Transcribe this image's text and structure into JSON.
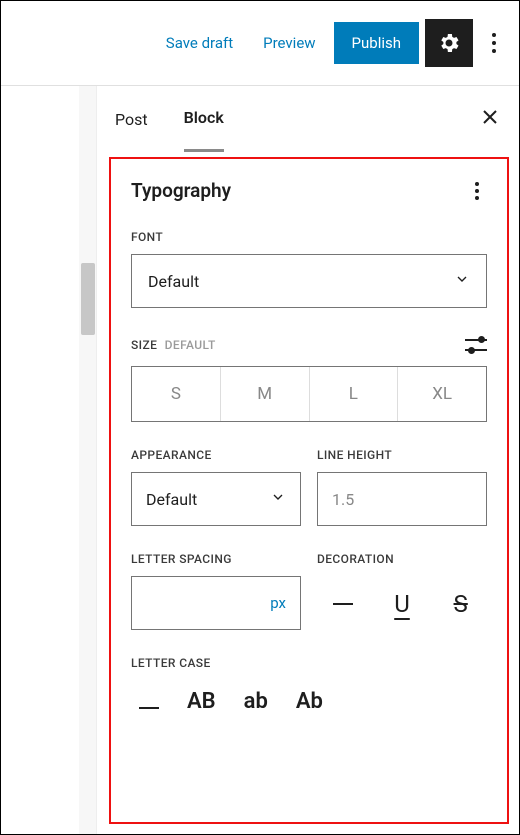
{
  "topbar": {
    "save_draft": "Save draft",
    "preview": "Preview",
    "publish": "Publish"
  },
  "tabs": {
    "post": "Post",
    "block": "Block"
  },
  "typography": {
    "title": "Typography",
    "font": {
      "label": "FONT",
      "value": "Default"
    },
    "size": {
      "label": "SIZE",
      "default_hint": "DEFAULT",
      "options": [
        "S",
        "M",
        "L",
        "XL"
      ]
    },
    "appearance": {
      "label": "APPEARANCE",
      "value": "Default"
    },
    "line_height": {
      "label": "LINE HEIGHT",
      "placeholder": "1.5"
    },
    "letter_spacing": {
      "label": "LETTER SPACING",
      "unit": "px"
    },
    "decoration": {
      "label": "DECORATION",
      "underline_glyph": "U",
      "strike_glyph": "S"
    },
    "letter_case": {
      "label": "LETTER CASE",
      "upper": "AB",
      "lower": "ab",
      "capitalize": "Ab"
    }
  }
}
